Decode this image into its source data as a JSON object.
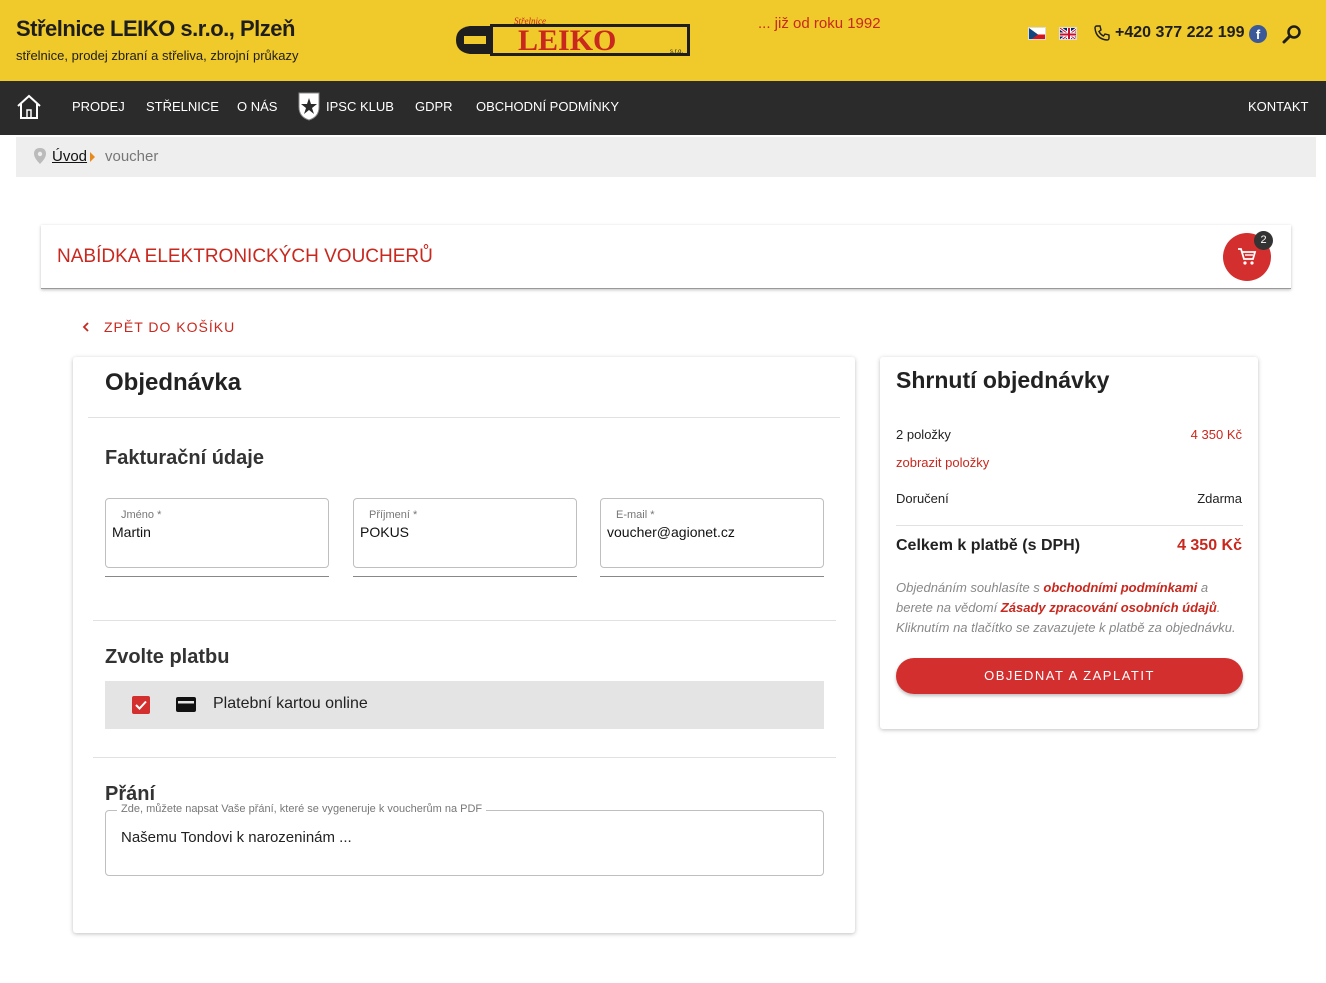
{
  "header": {
    "title": "Střelnice LEIKO s.r.o., Plzeň",
    "subtitle": "střelnice, prodej zbraní a střeliva, zbrojní průkazy",
    "logo_text": "LEIKO",
    "logo_small": "Střelnice",
    "logo_sro": "s.r.o.",
    "tagline": "... již od roku 1992",
    "phone": "+420 377 222 199",
    "icons": [
      "flag-cz-icon",
      "flag-en-icon",
      "phone-icon",
      "facebook-icon",
      "search-icon"
    ]
  },
  "nav": {
    "items": [
      "PRODEJ",
      "STŘELNICE",
      "O NÁS",
      "IPSC KLUB",
      "GDPR",
      "OBCHODNÍ PODMÍNKY"
    ],
    "contact": "KONTAKT"
  },
  "breadcrumb": {
    "home": "Úvod",
    "current": "voucher"
  },
  "offer": {
    "title": "NABÍDKA ELEKTRONICKÝCH VOUCHERŮ",
    "cart_count": "2"
  },
  "back_link": "ZPĚT DO KOŠÍKU",
  "order": {
    "title": "Objednávka",
    "billing_title": "Fakturační údaje",
    "fields": [
      {
        "label": "Jméno *",
        "value": "Martin"
      },
      {
        "label": "Příjmení *",
        "value": "POKUS"
      },
      {
        "label": "E-mail *",
        "value": "voucher@agionet.cz"
      }
    ],
    "payment_title": "Zvolte platbu",
    "payment_option": "Platební kartou online",
    "wish_title": "Přání",
    "wish_label": "Zde, můžete napsat Vaše přání, které se vygeneruje k voucherům na PDF",
    "wish_value": "Našemu Tondovi k narozeninám ..."
  },
  "summary": {
    "title": "Shrnutí objednávky",
    "items_label": "2 položky",
    "items_price": "4 350 Kč",
    "show_items": "zobrazit položky",
    "delivery_label": "Doručení",
    "delivery_value": "Zdarma",
    "total_label": "Celkem k platbě (s DPH)",
    "total_value": "4 350 Kč",
    "terms_1": "Objednáním souhlasíte s ",
    "terms_link1": "obchodními podmínkami",
    "terms_2": " a berete na vědomí ",
    "terms_link2": "Zásady zpracování osobních údajů",
    "terms_3": ". Kliknutím na tlačítko se zavazujete k platbě za objednávku.",
    "button": "OBJEDNAT A ZAPLATIT"
  },
  "colors": {
    "header_bg": "#f0c92a",
    "nav_bg": "#2b2b2b",
    "accent": "#d32f2f"
  }
}
